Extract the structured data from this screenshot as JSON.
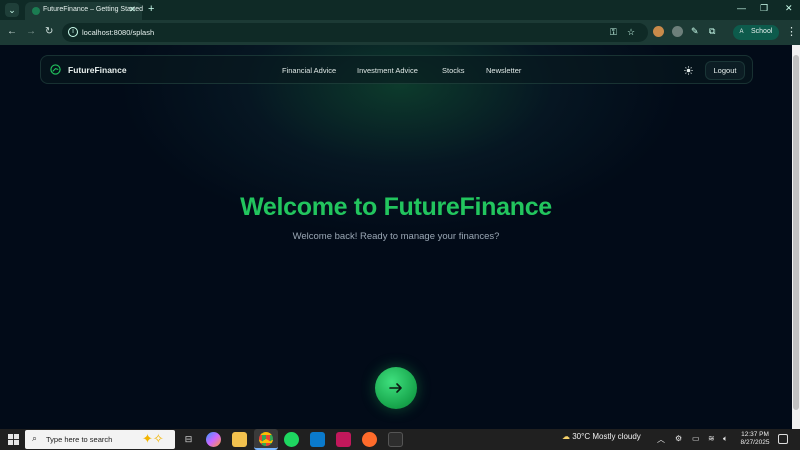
{
  "browser": {
    "tab_title": "FutureFinance – Getting Started",
    "tab_close": "✕",
    "new_tab": "+",
    "url": "localhost:8080/splash",
    "profile_initial": "A",
    "profile_label": "School",
    "window_controls": [
      "—",
      "❐",
      "✕"
    ]
  },
  "app": {
    "brand": "FutureFinance",
    "nav_links": [
      "Financial Advice",
      "Investment Advice",
      "Stocks",
      "Newsletter"
    ],
    "logout_label": "Logout"
  },
  "hero": {
    "title": "Welcome to FutureFinance",
    "subtitle": "Welcome back! Ready to manage your finances?"
  },
  "taskbar": {
    "search_placeholder": "Type here to search",
    "weather": "30°C  Mostly cloudy",
    "time": "12:37 PM",
    "date": "8/27/2025"
  },
  "colors": {
    "accent": "#22c55e",
    "page_bg": "#020b18",
    "chrome_bg": "#1c3a35"
  }
}
